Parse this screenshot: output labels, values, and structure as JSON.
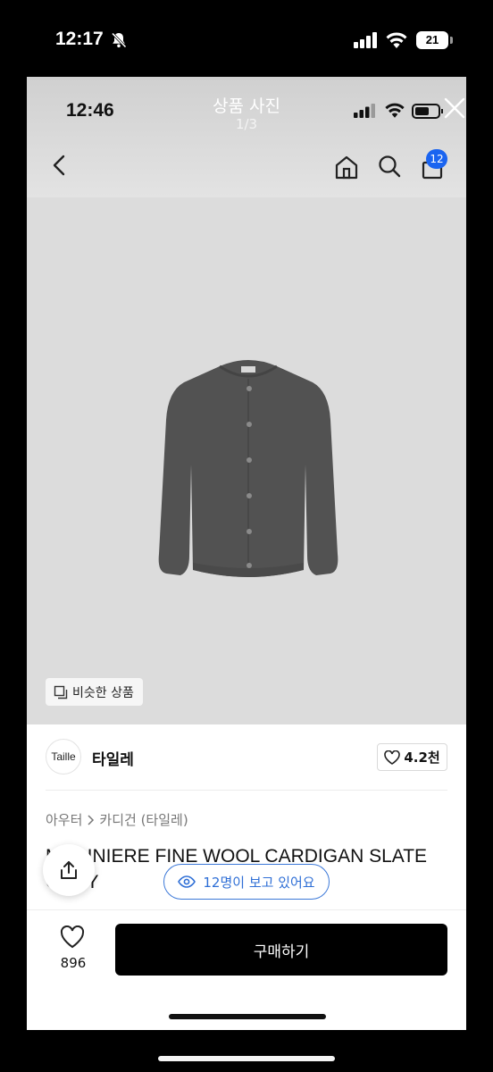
{
  "outer_status": {
    "time": "12:17",
    "battery": "21"
  },
  "viewer": {
    "time": "12:46",
    "title": "상품 사진",
    "counter": "1/3"
  },
  "nav": {
    "cart_badge": "12"
  },
  "similar_button": {
    "label": "비슷한 상품"
  },
  "brand": {
    "logo_text": "Taille",
    "name": "타일레",
    "likes": "4.2천"
  },
  "breadcrumb": {
    "level1": "아우터",
    "level2": "카디건 (타일레)"
  },
  "product": {
    "title": "MARINIERE FINE WOOL CARDIGAN SLATE GREY"
  },
  "viewers_pill": {
    "label": "12명이 보고 있어요"
  },
  "bottom_bar": {
    "wish_count": "896",
    "buy_label": "구매하기"
  },
  "colors": {
    "accent": "#1a64f0",
    "viewers": "#2f6fd6",
    "buy_bg": "#000000",
    "cardigan": "#525252"
  }
}
